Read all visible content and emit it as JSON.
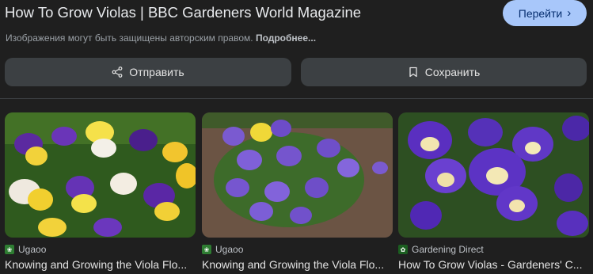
{
  "header": {
    "title": "How To Grow Violas | BBC Gardeners World Magazine",
    "go_label": "Перейти",
    "notice_text": "Изображения могут быть защищены авторским правом.",
    "notice_more": "Подробнее..."
  },
  "actions": {
    "share_label": "Отправить",
    "save_label": "Сохранить"
  },
  "related": [
    {
      "source": "Ugaoo",
      "caption": "Knowing and Growing the Viola Flo...",
      "favicon_color": "#2e7d32"
    },
    {
      "source": "Ugaoo",
      "caption": "Knowing and Growing the Viola Flo...",
      "favicon_color": "#2e7d32"
    },
    {
      "source": "Gardening Direct",
      "caption": "How To Grow Violas - Gardeners' C...",
      "favicon_color": "#1b5e20"
    }
  ],
  "colors": {
    "accent": "#a8c7fa",
    "button_bg": "#3c4043",
    "page_bg": "#1f1f1f"
  }
}
